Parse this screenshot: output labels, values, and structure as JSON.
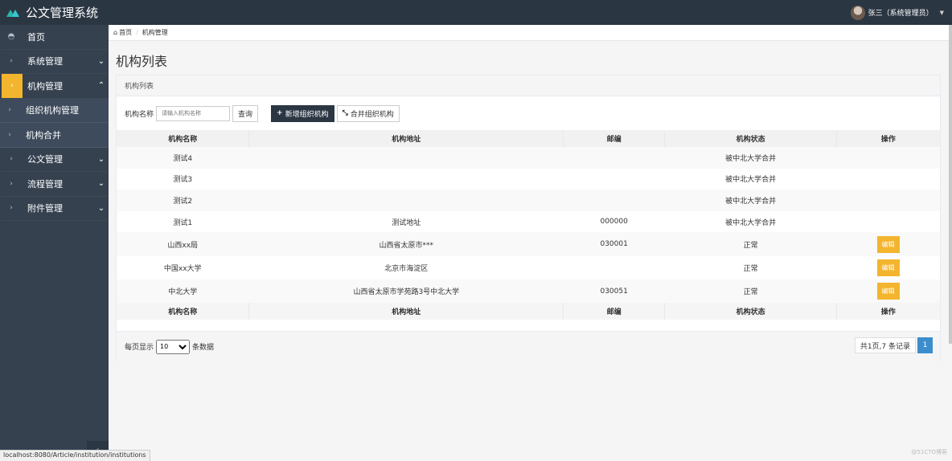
{
  "app": {
    "title": "公文管理系统"
  },
  "user": {
    "name": "张三（系统管理员）"
  },
  "sidebar": {
    "items": [
      {
        "label": "首页",
        "icon": "dashboard-icon"
      },
      {
        "label": "系统管理",
        "icon": "chevron-right-icon"
      },
      {
        "label": "机构管理",
        "icon": "chevron-right-icon",
        "open": true
      },
      {
        "label": "组织机构管理",
        "sub": true
      },
      {
        "label": "机构合并",
        "sub": true
      },
      {
        "label": "公文管理",
        "icon": "chevron-right-icon"
      },
      {
        "label": "流程管理",
        "icon": "chevron-right-icon"
      },
      {
        "label": "附件管理",
        "icon": "chevron-right-icon"
      }
    ]
  },
  "breadcrumb": {
    "home": "首页",
    "current": "机构管理"
  },
  "page": {
    "title": "机构列表"
  },
  "panel": {
    "heading": "机构列表"
  },
  "search": {
    "label": "机构名称",
    "placeholder": "请输入机构名称",
    "button": "查询"
  },
  "actions": {
    "add": "新增组织机构",
    "merge": "合并组织机构"
  },
  "table": {
    "headers": [
      "机构名称",
      "机构地址",
      "邮编",
      "机构状态",
      "操作"
    ],
    "rows": [
      {
        "name": "测试4",
        "address": "",
        "zip": "",
        "status": "被中北大学合并",
        "action": ""
      },
      {
        "name": "测试3",
        "address": "",
        "zip": "",
        "status": "被中北大学合并",
        "action": ""
      },
      {
        "name": "测试2",
        "address": "",
        "zip": "",
        "status": "被中北大学合并",
        "action": ""
      },
      {
        "name": "测试1",
        "address": "测试地址",
        "zip": "000000",
        "status": "被中北大学合并",
        "action": ""
      },
      {
        "name": "山西xx局",
        "address": "山西省太原市***",
        "zip": "030001",
        "status": "正常",
        "action": "编辑"
      },
      {
        "name": "中国xx大学",
        "address": "北京市海淀区",
        "zip": "",
        "status": "正常",
        "action": "编辑"
      },
      {
        "name": "中北大学",
        "address": "山西省太原市学苑路3号中北大学",
        "zip": "030051",
        "status": "正常",
        "action": "编辑"
      }
    ]
  },
  "pager": {
    "per_page_label": "每页显示",
    "per_page_value": "10",
    "per_page_suffix": "条数据",
    "info": "共1页,7 条记录",
    "current_page": "1"
  },
  "status_url": "localhost:8080/Article/institution/institutions",
  "watermark": "@51CTO博客"
}
